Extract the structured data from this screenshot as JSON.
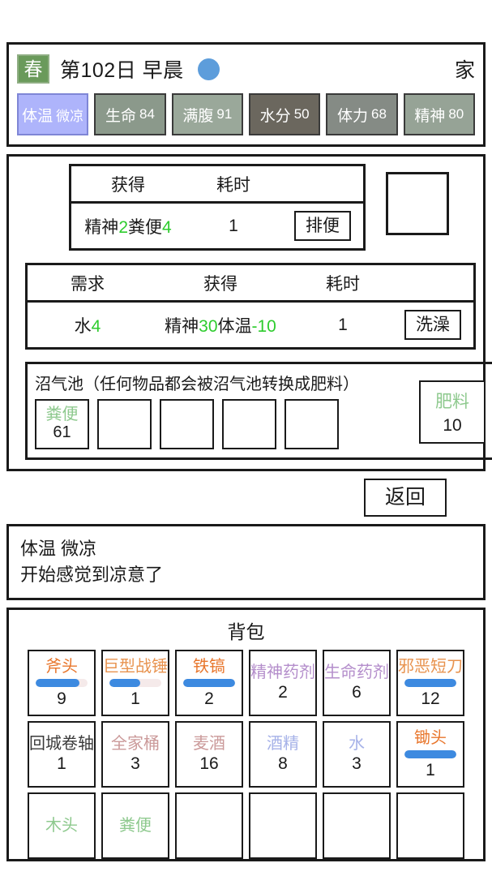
{
  "header": {
    "season": "春",
    "day_text": "第102日 早晨",
    "weather_icon": "sun-circle-icon",
    "weather_color": "#5d9ddb",
    "location": "家",
    "stats": [
      {
        "name": "体温",
        "value": "微凉",
        "bg": "#aeb4fb",
        "is_temp": true
      },
      {
        "name": "生命",
        "value": "84",
        "bg": "#8b998b",
        "is_temp": false
      },
      {
        "name": "满腹",
        "value": "91",
        "bg": "#9aa89a",
        "is_temp": false
      },
      {
        "name": "水分",
        "value": "50",
        "bg": "#6b675e",
        "is_temp": false
      },
      {
        "name": "体力",
        "value": "68",
        "bg": "#858b85",
        "is_temp": false
      },
      {
        "name": "精神",
        "value": "80",
        "bg": "#96a396",
        "is_temp": false
      }
    ]
  },
  "actions": [
    {
      "id": "defecate",
      "headers": {
        "gain": "获得",
        "time": "耗时"
      },
      "gain_parts": [
        {
          "text": "精神",
          "type": "label"
        },
        {
          "text": "2",
          "type": "gain"
        },
        {
          "text": "粪便",
          "type": "label"
        },
        {
          "text": "4",
          "type": "gain"
        }
      ],
      "time": "1",
      "button": "排便"
    }
  ],
  "action2": {
    "id": "bathe",
    "headers": {
      "need": "需求",
      "gain": "获得",
      "time": "耗时"
    },
    "need_parts": [
      {
        "text": "水",
        "type": "label"
      },
      {
        "text": "4",
        "type": "gain"
      }
    ],
    "gain_parts": [
      {
        "text": "精神",
        "type": "label"
      },
      {
        "text": "30",
        "type": "gain"
      },
      {
        "text": "体温",
        "type": "label"
      },
      {
        "text": "-10",
        "type": "gain"
      }
    ],
    "time": "1",
    "button": "洗澡"
  },
  "empty_slot_label": "",
  "biogas": {
    "title": "沼气池（任何物品都会被沼气池转换成肥料）",
    "slots": [
      {
        "name": "粪便",
        "count": "61"
      },
      {
        "name": "",
        "count": ""
      },
      {
        "name": "",
        "count": ""
      },
      {
        "name": "",
        "count": ""
      },
      {
        "name": "",
        "count": ""
      }
    ],
    "output": {
      "name": "肥料",
      "count": "10"
    }
  },
  "back_button": "返回",
  "log": {
    "lines": [
      "体温 微凉",
      "开始感觉到凉意了"
    ]
  },
  "backpack": {
    "title": "背包",
    "items": [
      {
        "name": "斧头",
        "count": "9",
        "color": "#e8762c",
        "durability": 85
      },
      {
        "name": "巨型战锤",
        "count": "1",
        "color": "#e8934f",
        "durability": 60
      },
      {
        "name": "铁镐",
        "count": "2",
        "color": "#e8762c",
        "durability": 100
      },
      {
        "name": "精神药剂",
        "count": "2",
        "color": "#b48ecb",
        "durability": null
      },
      {
        "name": "生命药剂",
        "count": "6",
        "color": "#b48ecb",
        "durability": null
      },
      {
        "name": "邪恶短刀",
        "count": "12",
        "color": "#e8934f",
        "durability": 100
      },
      {
        "name": "回城卷轴",
        "count": "1",
        "color": "#3a3a3a",
        "durability": null
      },
      {
        "name": "全家桶",
        "count": "3",
        "color": "#cb9a9a",
        "durability": null
      },
      {
        "name": "麦酒",
        "count": "16",
        "color": "#cb9a9a",
        "durability": null
      },
      {
        "name": "酒精",
        "count": "8",
        "color": "#a6b2e8",
        "durability": null
      },
      {
        "name": "水",
        "count": "3",
        "color": "#a6b2e8",
        "durability": null
      },
      {
        "name": "锄头",
        "count": "1",
        "color": "#e8762c",
        "durability": 100
      },
      {
        "name": "木头",
        "count": "",
        "color": "#8ec98e",
        "durability": null
      },
      {
        "name": "粪便",
        "count": "",
        "color": "#8ec98e",
        "durability": null
      },
      {
        "name": "",
        "count": "",
        "color": "#1a1a1a",
        "durability": null
      },
      {
        "name": "",
        "count": "",
        "color": "#1a1a1a",
        "durability": null
      },
      {
        "name": "",
        "count": "",
        "color": "#1a1a1a",
        "durability": null
      },
      {
        "name": "",
        "count": "",
        "color": "#1a1a1a",
        "durability": null
      }
    ]
  }
}
